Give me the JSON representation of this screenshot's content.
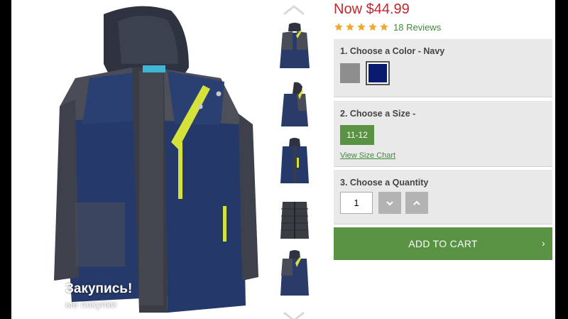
{
  "product": {
    "price": "Now $44.99",
    "rating_stars": 5,
    "reviews_link": "18 Reviews"
  },
  "color_panel": {
    "title": "1. Choose a Color - Navy",
    "swatches": [
      {
        "name": "Grey",
        "color": "#8e8e8e",
        "selected": false
      },
      {
        "name": "Navy",
        "color": "#0a1a6e",
        "selected": true
      }
    ]
  },
  "size_panel": {
    "title": "2. Choose a Size -",
    "selected_size": "11-12",
    "size_chart_link": "View Size Chart"
  },
  "quantity_panel": {
    "title": "3. Choose a Quantity",
    "value": "1"
  },
  "add_to_cart": {
    "label": "ADD TO CART",
    "chevron": "›"
  },
  "toast": {
    "title": "Закупись!",
    "subtitle": "ые покупки"
  },
  "colors": {
    "price": "#c1272d",
    "accent_green": "#5a9244",
    "link_green": "#3f8a3a",
    "star": "#f0a830",
    "panel_bg": "#e9e9e9"
  },
  "icons": {
    "thumb_up_arrow": "chevron-up-icon",
    "thumb_down_arrow": "chevron-down-icon",
    "qty_decrease": "chevron-down-icon",
    "qty_increase": "chevron-up-icon",
    "star": "star-icon"
  }
}
